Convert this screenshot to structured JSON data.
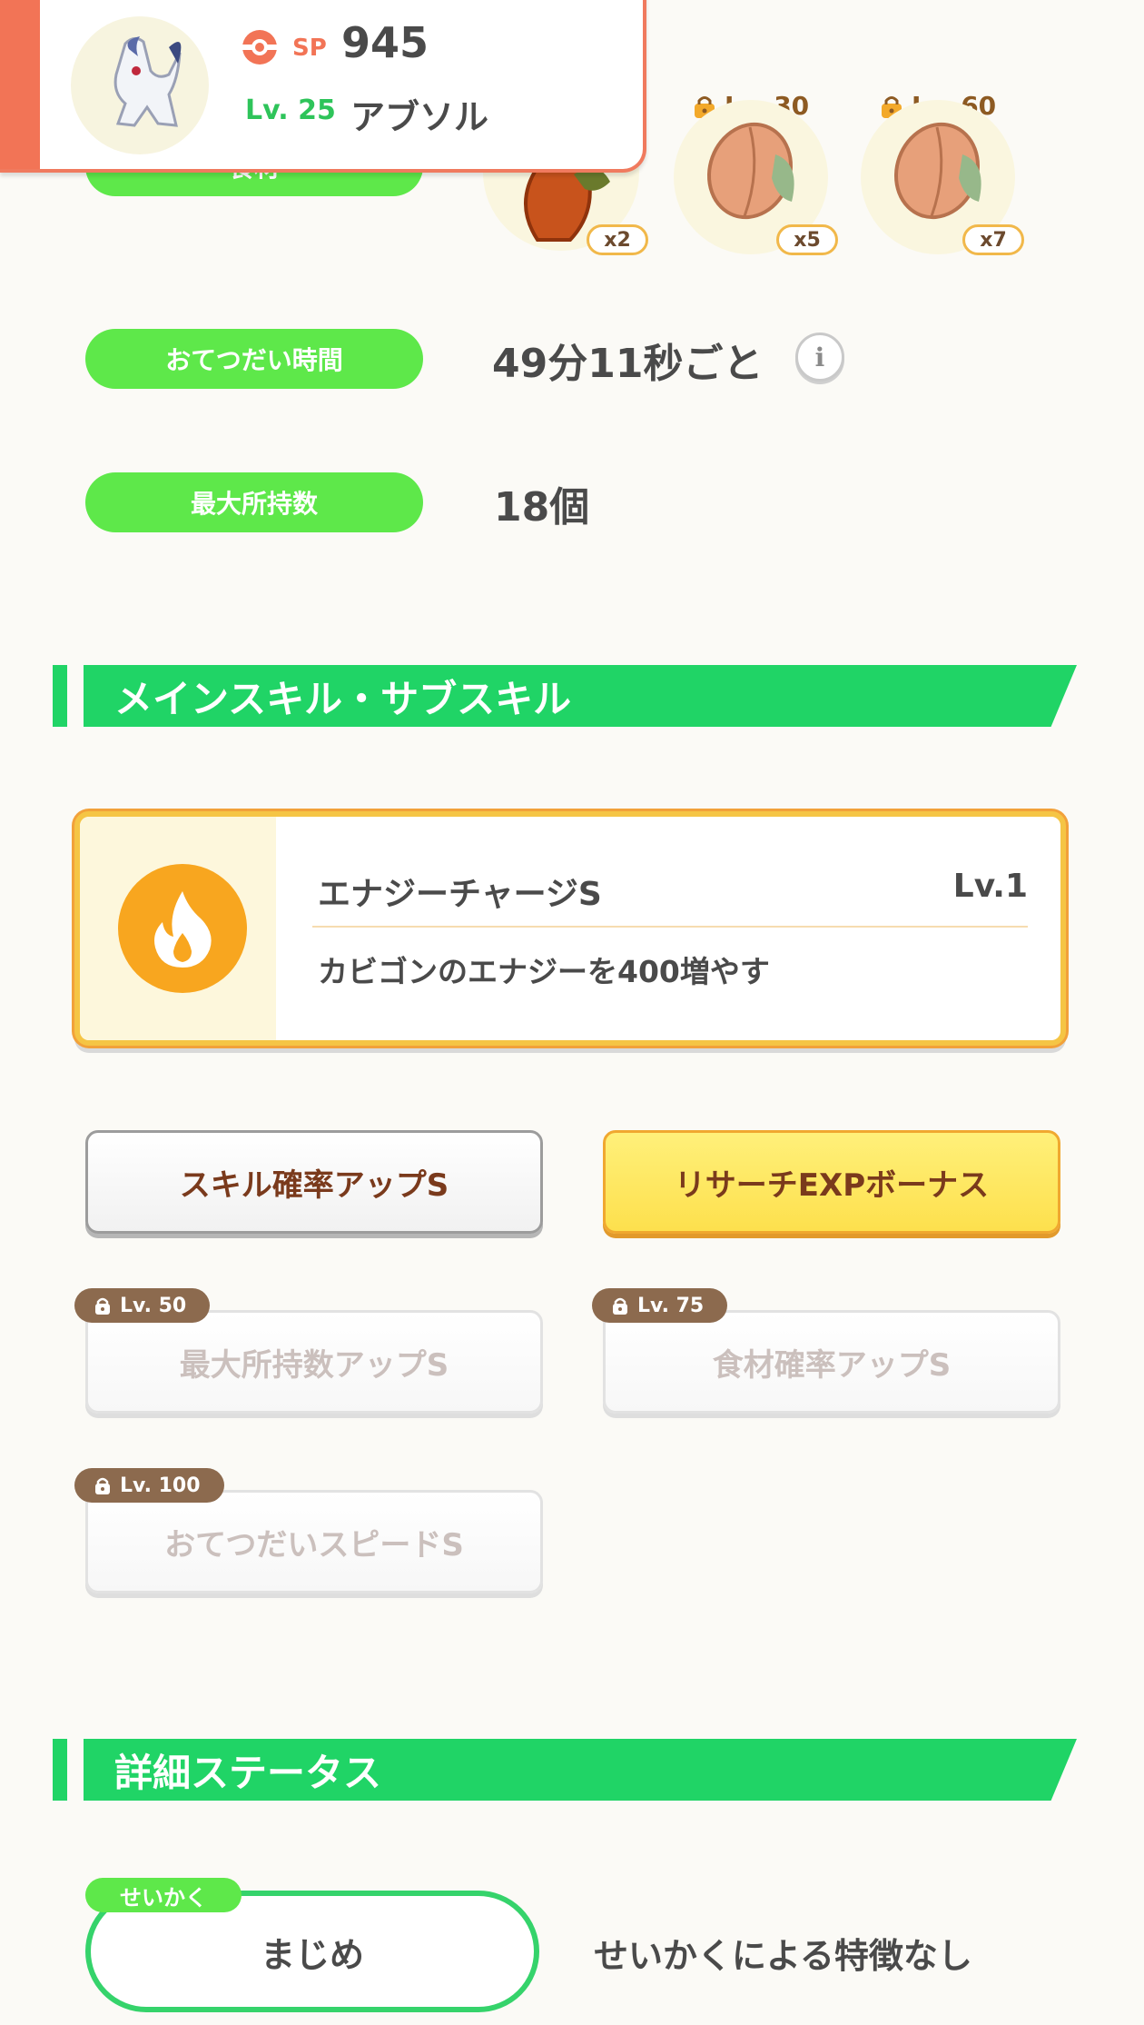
{
  "header": {
    "sp_icon": "pokeball-icon",
    "sp_label": "SP",
    "sp_value": "945",
    "level": "Lv. 25",
    "name": "アブソル"
  },
  "ingredients": {
    "label": "食材",
    "items": [
      {
        "count": "x2",
        "locked": false,
        "icon": "cacao-icon"
      },
      {
        "count": "x5",
        "locked": true,
        "unlock_level": "Lv. 30",
        "icon": "cacao-icon"
      },
      {
        "count": "x7",
        "locked": true,
        "unlock_level": "Lv. 60",
        "icon": "cacao-icon"
      }
    ]
  },
  "help_time": {
    "label": "おてつだい時間",
    "value": "49分11秒ごと"
  },
  "max_carry": {
    "label": "最大所持数",
    "value": "18個"
  },
  "skills_section": {
    "title": "メインスキル・サブスキル",
    "main_skill": {
      "icon": "fire-icon",
      "name": "エナジーチャージS",
      "level": "Lv.1",
      "description": "カビゴンのエナジーを400増やす"
    },
    "sub_skills": [
      {
        "label": "スキル確率アップS",
        "style": "white",
        "locked": false
      },
      {
        "label": "リサーチEXPボーナス",
        "style": "gold",
        "locked": false
      },
      {
        "label": "最大所持数アップS",
        "locked": true,
        "unlock_level": "Lv. 50"
      },
      {
        "label": "食材確率アップS",
        "locked": true,
        "unlock_level": "Lv. 75"
      },
      {
        "label": "おてつだいスピードS",
        "locked": true,
        "unlock_level": "Lv. 100"
      }
    ]
  },
  "details_section": {
    "title": "詳細ステータス",
    "nature_tag": "せいかく",
    "nature": "まじめ",
    "nature_effect": "せいかくによる特徴なし"
  },
  "colors": {
    "accent_green": "#20d466",
    "pill_green": "#5ee84a",
    "header_orange": "#f27456",
    "skill_gold": "#f5c545",
    "lock_brown": "#8c6a4e"
  }
}
